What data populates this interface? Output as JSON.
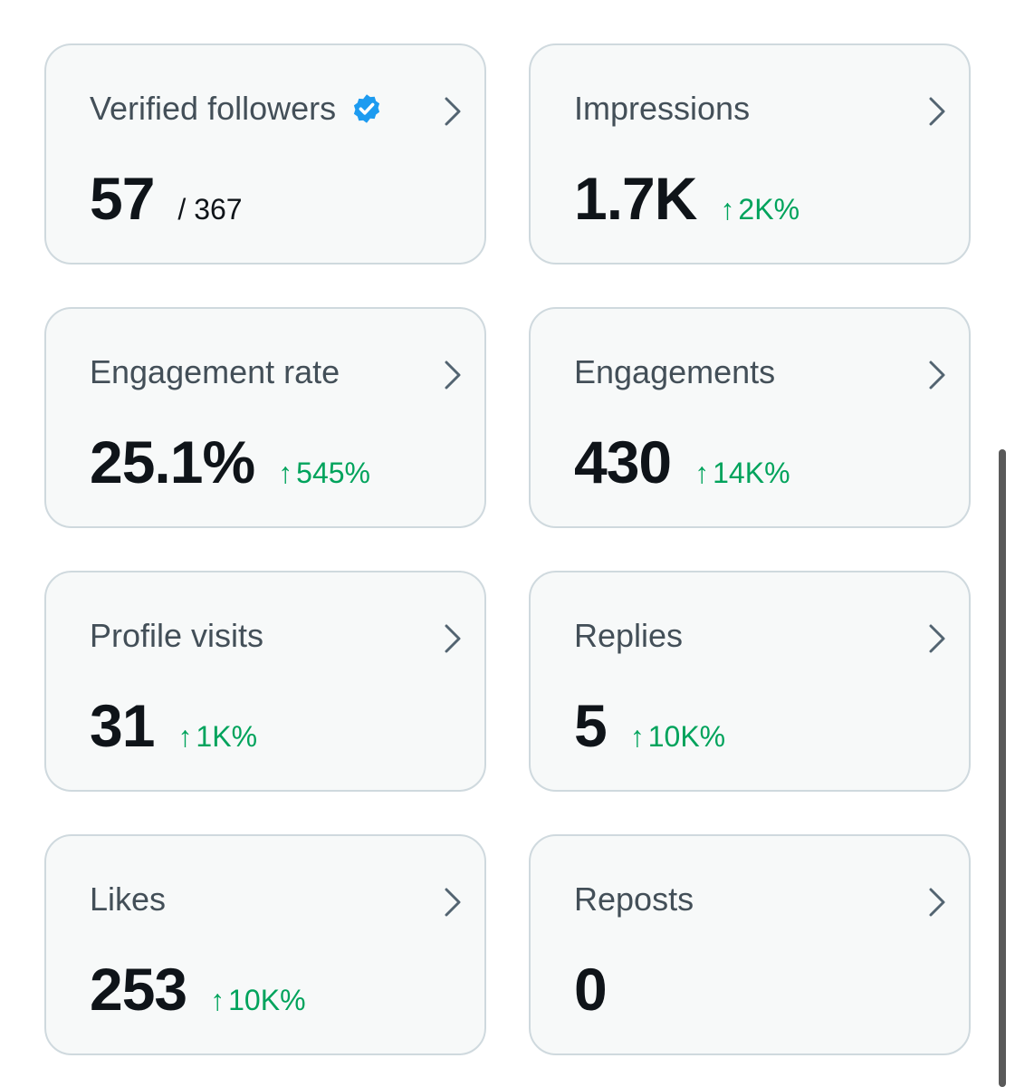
{
  "cards": [
    {
      "title": "Verified followers",
      "value": "57",
      "sub_value": "/ 367",
      "change": ""
    },
    {
      "title": "Impressions",
      "value": "1.7K",
      "sub_value": "",
      "change": "2K%"
    },
    {
      "title": "Engagement rate",
      "value": "25.1%",
      "sub_value": "",
      "change": "545%"
    },
    {
      "title": "Engagements",
      "value": "430",
      "sub_value": "",
      "change": "14K%"
    },
    {
      "title": "Profile visits",
      "value": "31",
      "sub_value": "",
      "change": "1K%"
    },
    {
      "title": "Replies",
      "value": "5",
      "sub_value": "",
      "change": "10K%"
    },
    {
      "title": "Likes",
      "value": "253",
      "sub_value": "",
      "change": "10K%"
    },
    {
      "title": "Reposts",
      "value": "0",
      "sub_value": "",
      "change": ""
    }
  ],
  "up_arrow": "↑",
  "icons": {
    "verified": "verified-badge-icon",
    "chevron": "chevron-right-icon"
  },
  "colors": {
    "positive_change": "#00a35c",
    "verified_badge": "#1d9bf0",
    "card_background": "#f7f9f9",
    "card_border": "#cfd9de"
  }
}
